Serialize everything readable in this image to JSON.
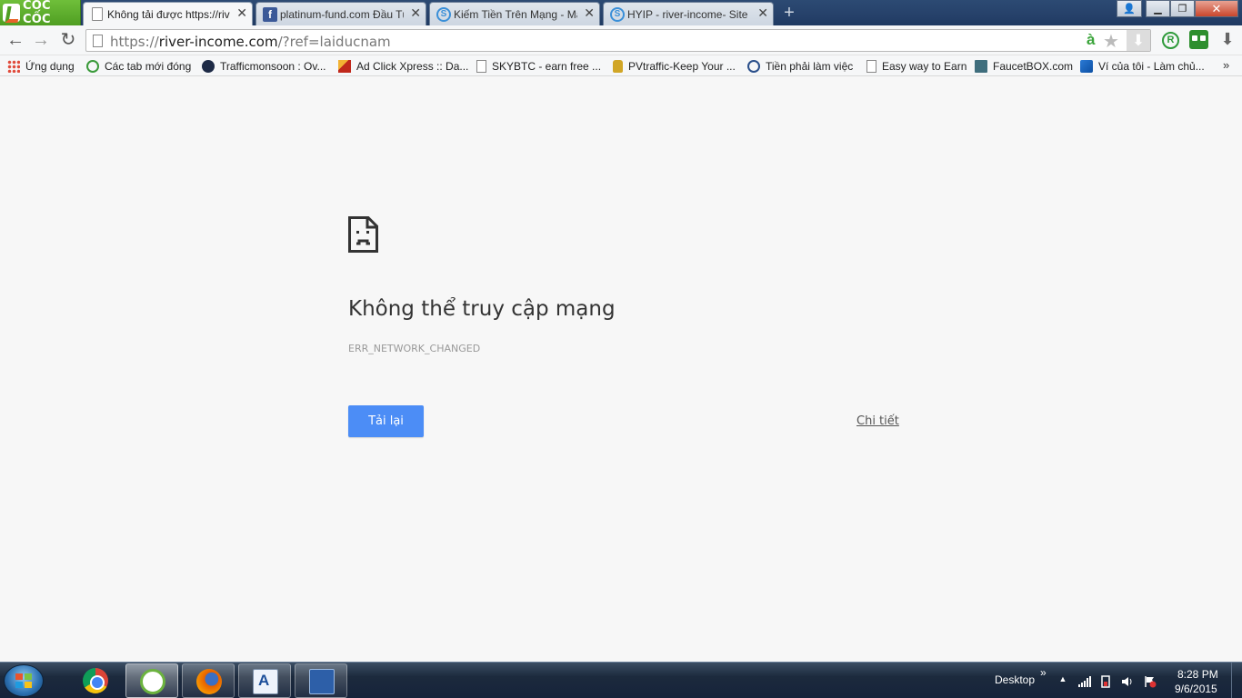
{
  "browser": {
    "brand": "CỐC CỐC",
    "tabs": [
      {
        "title": "Không tải được https://rive",
        "icon": "page-icon",
        "active": true
      },
      {
        "title": "platinum-fund.com Đầu Tư",
        "icon": "facebook-icon",
        "active": false
      },
      {
        "title": "Kiếm Tiền Trên Mạng - Ma",
        "icon": "s-icon",
        "active": false
      },
      {
        "title": "HYIP - river-income- Site c",
        "icon": "s-icon",
        "active": false
      }
    ],
    "close_glyph": "✕",
    "new_tab_glyph": "+",
    "window_controls": {
      "user": "👤",
      "minimize": "▁",
      "maximize": "❐",
      "close": "✕"
    }
  },
  "toolbar": {
    "back": "←",
    "forward": "→",
    "reload": "↻",
    "url_scheme": "https://",
    "url_host": "river-income.com",
    "url_rest": "/?ref=laiducnam",
    "vietnamese_a": "à",
    "star": "★",
    "download": "⬇",
    "ext_r": "R",
    "menu": "⬇"
  },
  "bookmarks": [
    {
      "label": "Ứng dụng",
      "icon": "apps-icon"
    },
    {
      "label": "Các tab mới đóng",
      "icon": "history-icon"
    },
    {
      "label": "Trafficmonsoon : Ov...",
      "icon": "trafficmonsoon-icon"
    },
    {
      "label": "Ad Click Xpress :: Da...",
      "icon": "adclick-icon"
    },
    {
      "label": "SKYBTC - earn free ...",
      "icon": "page-icon"
    },
    {
      "label": "PVtraffic-Keep Your ...",
      "icon": "lock-icon"
    },
    {
      "label": "Tiền phải làm việc",
      "icon": "circle-icon"
    },
    {
      "label": "Easy way to Earn",
      "icon": "page-icon"
    },
    {
      "label": "FaucetBOX.com",
      "icon": "folder-icon"
    },
    {
      "label": "Ví của tôi - Làm chủ...",
      "icon": "cube-icon"
    }
  ],
  "bookmarks_more": "»",
  "error": {
    "title": "Không thể truy cập mạng",
    "code": "ERR_NETWORK_CHANGED",
    "reload_label": "Tải lại",
    "details_label": "Chi tiết"
  },
  "taskbar": {
    "apps": [
      "chrome-icon",
      "coccoc-icon",
      "firefox-icon",
      "wordpad-icon",
      "keyboard-icon"
    ],
    "desktop_label": "Desktop",
    "desktop_chevron": "»",
    "tray_up": "▲",
    "time": "8:28 PM",
    "date": "9/6/2015"
  }
}
